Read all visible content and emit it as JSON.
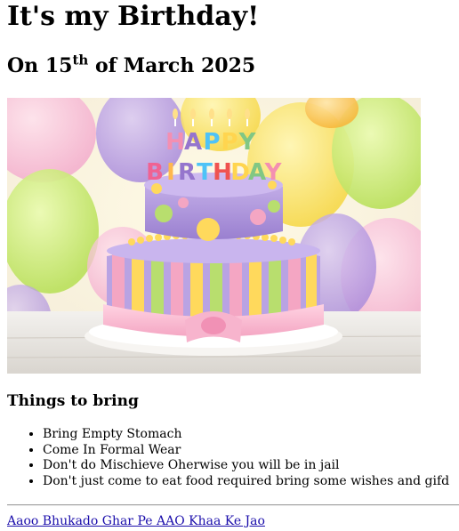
{
  "heading": "It's my Birthday!",
  "date_line": {
    "prefix": "On 15",
    "suffix": "th",
    "rest": " of March 2025"
  },
  "image": {
    "cake_letters_top": [
      "H",
      "A",
      "P",
      "P",
      "Y"
    ],
    "cake_letters_bottom": [
      "B",
      "I",
      "R",
      "T",
      "H",
      "D",
      "A",
      "Y"
    ]
  },
  "things_heading": "Things to bring",
  "things_list": [
    "Bring Empty Stomach",
    "Come In Formal Wear",
    "Don't do Mischieve Oherwise you will be in jail",
    "Don't just come to eat food required bring some wishes and gifd"
  ],
  "footer_link": "Aaoo Bhukado Ghar Pe AAO Khaa Ke Jao",
  "colors": {
    "link": "#1a0dab",
    "cake_top": "#b39ddb",
    "cake_bottom_stripes": [
      "#f48fb1",
      "#ffd54f",
      "#aed581",
      "#9575cd"
    ]
  }
}
